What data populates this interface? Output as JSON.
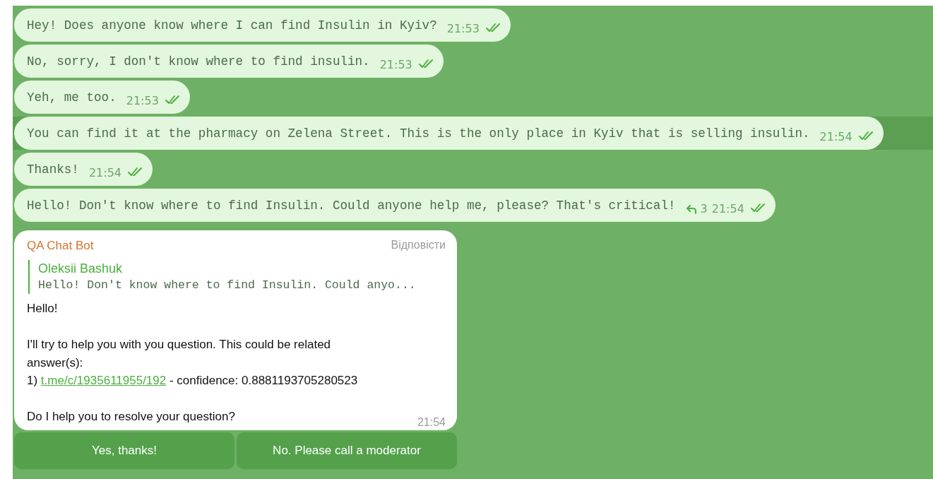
{
  "messages": [
    {
      "text": "Hey! Does anyone know where I can find Insulin in Kyiv?",
      "time": "21:53",
      "read": true,
      "highlighted": false
    },
    {
      "text": "No, sorry, I don't know where to find insulin.",
      "time": "21:53",
      "read": true,
      "highlighted": false
    },
    {
      "text": "Yeh, me too.",
      "time": "21:53",
      "read": true,
      "highlighted": false
    },
    {
      "text": "You can find it at the pharmacy on Zelena Street. This is the only place in Kyiv that is selling insulin.",
      "time": "21:54",
      "read": true,
      "highlighted": true
    },
    {
      "text": "Thanks!",
      "time": "21:54",
      "read": true,
      "highlighted": false
    },
    {
      "text": "Hello! Don't know where to find Insulin. Could anyone help me, please? That's critical!",
      "replies": "3",
      "time": "21:54",
      "read": true,
      "highlighted": false
    }
  ],
  "bot_message": {
    "sender": "QA Chat Bot",
    "reply_action": "Відповісти",
    "quote": {
      "author": "Oleksii Bashuk",
      "text": "Hello! Don't know where to find Insulin. Could anyo..."
    },
    "greeting": "Hello!",
    "intro": "I'll try to help you with you question. This could be related answer(s):",
    "answer": {
      "prefix": "1)",
      "link": "t.me/c/1935611955/192",
      "suffix": "- confidence: 0.8881193705280523"
    },
    "question": "Do I help you to resolve your question?",
    "time": "21:54",
    "buttons": [
      "Yes, thanks!",
      "No. Please call a moderator"
    ]
  }
}
